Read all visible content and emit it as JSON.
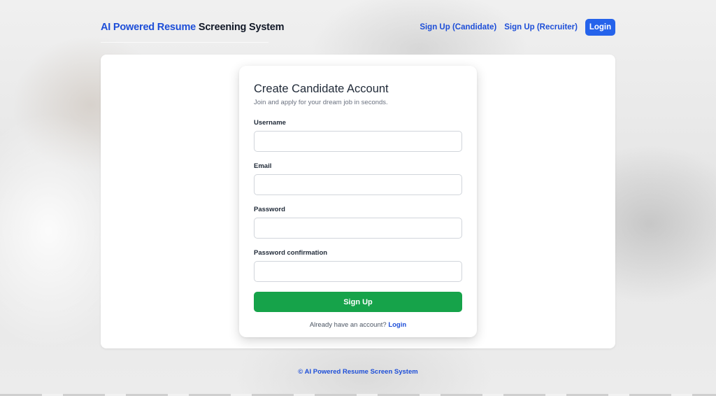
{
  "brand": {
    "highlight": "AI Powered Resume",
    "rest": " Screening System",
    "highlight_color": "#1d4ed8"
  },
  "nav": {
    "signup_candidate": "Sign Up (Candidate)",
    "signup_recruiter": "Sign Up (Recruiter)",
    "login": "Login",
    "button_color": "#2563eb"
  },
  "form": {
    "title": "Create Candidate Account",
    "subtitle": "Join and apply for your dream job in seconds.",
    "fields": [
      {
        "label": "Username",
        "value": "",
        "placeholder": ""
      },
      {
        "label": "Email",
        "value": "",
        "placeholder": ""
      },
      {
        "label": "Password",
        "value": "",
        "placeholder": ""
      },
      {
        "label": "Password confirmation",
        "value": "",
        "placeholder": ""
      }
    ],
    "submit": "Sign Up",
    "submit_color": "#16a34a",
    "alt_text": "Already have an account?",
    "alt_link": "Login"
  },
  "footer": {
    "symbol": "©",
    "text": "AI Powered Resume Screen System"
  }
}
